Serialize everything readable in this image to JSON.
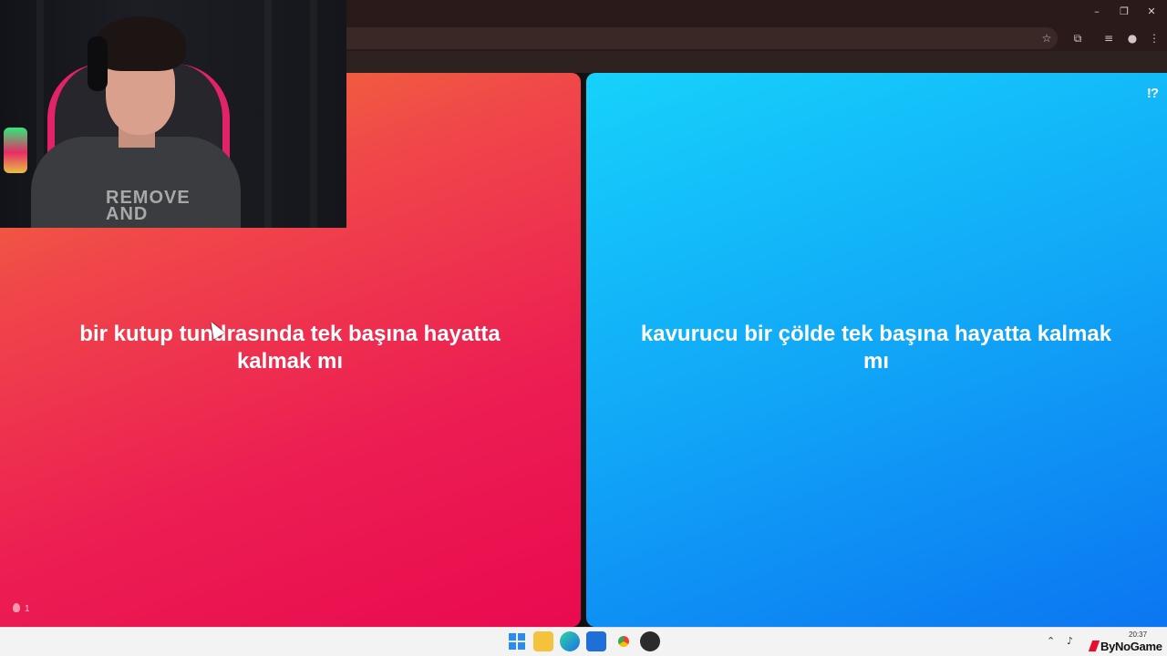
{
  "window": {
    "minimize_glyph": "–",
    "restore_glyph": "❐",
    "close_glyph": "✕"
  },
  "toolbar": {
    "bookmark_icon": "star-icon",
    "extensions_icon": "puzzle-icon",
    "media_icon": "media-icon",
    "profile_icon": "profile-icon",
    "menu_icon": "kebab-icon"
  },
  "question": {
    "option_left": "bir kutup tundrasında tek başına hayatta kalmak mı",
    "option_right": "kavurucu bir çölde tek başına hayatta kalmak mı",
    "help_label": "!?",
    "like_count": "1"
  },
  "colors": {
    "left_card_top": "#f27632",
    "left_card_bottom": "#e90a4f",
    "right_card_top": "#16d2fb",
    "right_card_bottom": "#0b75f1"
  },
  "webcam": {
    "shirt_text": "REMOVE\nAND"
  },
  "taskbar": {
    "apps": [
      "start-icon",
      "file-explorer-icon",
      "edge-icon",
      "store-icon",
      "chrome-icon",
      "obs-icon"
    ],
    "clock": "20:37",
    "watermark": "ByNoGame"
  }
}
